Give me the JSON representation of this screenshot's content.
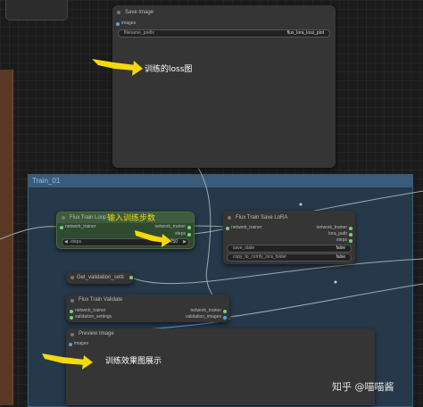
{
  "save_image": {
    "title": "Save Image",
    "input_images": "images",
    "filename_prefix_label": "filename_prefix",
    "filename_prefix_value": "flux_lora_loss_plot"
  },
  "group": {
    "title": "Train_01"
  },
  "train_loop": {
    "title": "Flux Train Loop",
    "input_network_trainer": "network_trainer",
    "output_network_trainer": "network_trainer",
    "output_steps": "steps",
    "steps_label": "steps",
    "steps_value": "750"
  },
  "save_lora": {
    "title": "Flux Train Save LoRA",
    "input_network_trainer": "network_trainer",
    "output_network_trainer": "network_trainer",
    "output_lora_path": "lora_path",
    "output_steps": "steps",
    "save_state_label": "save_state",
    "save_state_value": "false",
    "copy_label": "copy_to_comfy_lora_folder",
    "copy_value": "false"
  },
  "validation_settings_node": {
    "title": "Get_validation_setti"
  },
  "train_validate": {
    "title": "Flux Train Validate",
    "input_network_trainer": "network_trainer",
    "input_validation_settings": "validation_settings",
    "output_network_trainer": "network_trainer",
    "output_validation_images": "validation_images"
  },
  "preview_image": {
    "title": "Preview Image",
    "input_images": "images"
  },
  "annotations": {
    "loss": "训练的loss图",
    "steps": "输入训练步数",
    "preview": "训练效果图展示"
  },
  "watermark": "知乎 @喵喵酱",
  "colors": {
    "canvas": "#1b1b1b",
    "node": "#353535",
    "group": "#26394a",
    "group_header": "#3a5b7a",
    "train_loop_node": "#2f4a2f",
    "arrow": "#f4d90c",
    "slot_green": "#7ad07a",
    "slot_blue": "#5aa0e0"
  }
}
